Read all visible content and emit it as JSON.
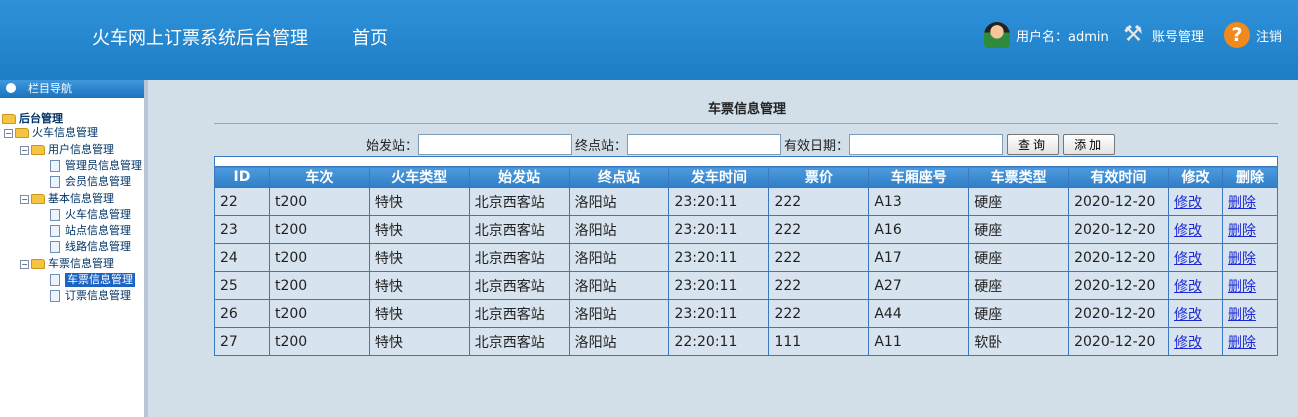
{
  "header": {
    "app_title": "火车网上订票系统后台管理",
    "home_label": "首页",
    "user_label": "用户名：admin",
    "account_label": "账号管理",
    "logout_label": "注销"
  },
  "sidebar": {
    "title": "栏目导航",
    "root": "后台管理",
    "train_info": "火车信息管理",
    "user_info": "用户信息管理",
    "admin_info": "管理员信息管理",
    "member_info": "会员信息管理",
    "basic_info": "基本信息管理",
    "train_basic": "火车信息管理",
    "station_info": "站点信息管理",
    "route_info": "线路信息管理",
    "ticket_group": "车票信息管理",
    "ticket_info": "车票信息管理",
    "order_info": "订票信息管理"
  },
  "main": {
    "title": "车票信息管理",
    "search": {
      "from_label": "始发站：",
      "to_label": "终点站：",
      "date_label": "有效日期：",
      "from_value": "",
      "to_value": "",
      "date_value": "",
      "query_button": "查询",
      "add_button": "添加"
    },
    "columns": [
      "ID",
      "车次",
      "火车类型",
      "始发站",
      "终点站",
      "发车时间",
      "票价",
      "车厢座号",
      "车票类型",
      "有效时间",
      "修改",
      "删除"
    ],
    "rows": [
      {
        "id": "22",
        "train": "t200",
        "type": "特快",
        "from": "北京西客站",
        "to": "洛阳站",
        "time": "23:20:11",
        "price": "222",
        "seat": "A13",
        "ticket_type": "硬座",
        "valid": "2020-12-20",
        "edit": "修改",
        "del": "删除"
      },
      {
        "id": "23",
        "train": "t200",
        "type": "特快",
        "from": "北京西客站",
        "to": "洛阳站",
        "time": "23:20:11",
        "price": "222",
        "seat": "A16",
        "ticket_type": "硬座",
        "valid": "2020-12-20",
        "edit": "修改",
        "del": "删除"
      },
      {
        "id": "24",
        "train": "t200",
        "type": "特快",
        "from": "北京西客站",
        "to": "洛阳站",
        "time": "23:20:11",
        "price": "222",
        "seat": "A17",
        "ticket_type": "硬座",
        "valid": "2020-12-20",
        "edit": "修改",
        "del": "删除"
      },
      {
        "id": "25",
        "train": "t200",
        "type": "特快",
        "from": "北京西客站",
        "to": "洛阳站",
        "time": "23:20:11",
        "price": "222",
        "seat": "A27",
        "ticket_type": "硬座",
        "valid": "2020-12-20",
        "edit": "修改",
        "del": "删除"
      },
      {
        "id": "26",
        "train": "t200",
        "type": "特快",
        "from": "北京西客站",
        "to": "洛阳站",
        "time": "23:20:11",
        "price": "222",
        "seat": "A44",
        "ticket_type": "硬座",
        "valid": "2020-12-20",
        "edit": "修改",
        "del": "删除"
      },
      {
        "id": "27",
        "train": "t200",
        "type": "特快",
        "from": "北京西客站",
        "to": "洛阳站",
        "time": "22:20:11",
        "price": "111",
        "seat": "A11",
        "ticket_type": "软卧",
        "valid": "2020-12-20",
        "edit": "修改",
        "del": "删除"
      }
    ]
  },
  "icons": {
    "user": "user-avatar-icon",
    "account": "tools-icon",
    "logout": "help-icon"
  },
  "colors": {
    "header_bg": "#1d7dc6",
    "table_header_bg": "#2f7fc8",
    "link": "#1c29d6",
    "page_bg": "#d2dfe9"
  }
}
